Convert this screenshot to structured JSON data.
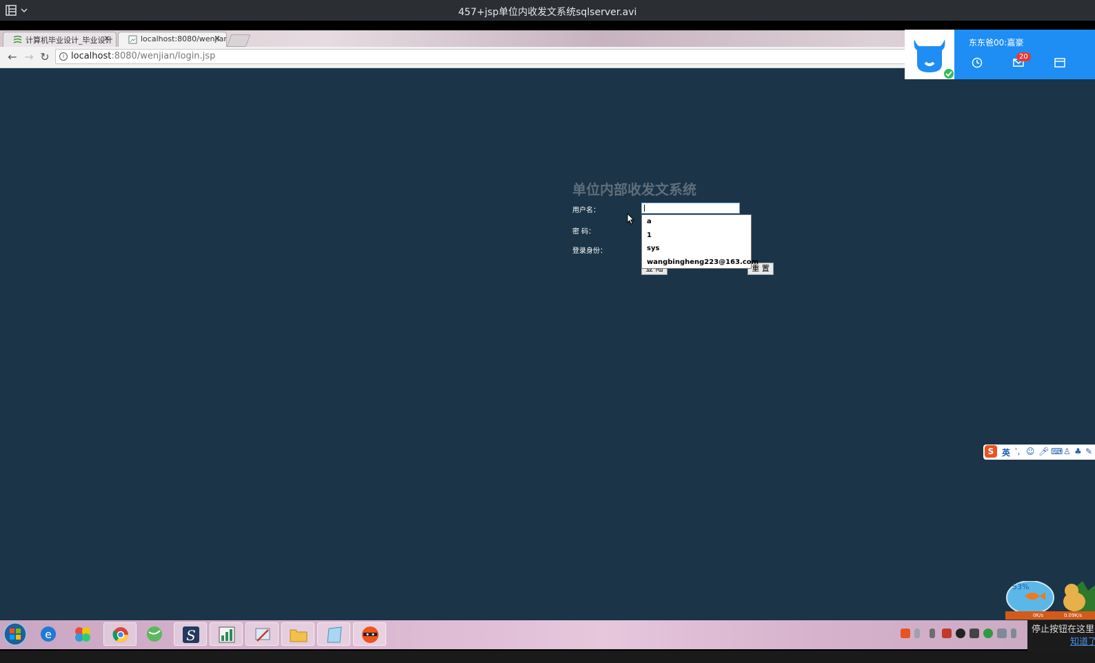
{
  "player": {
    "title": "457+jsp单位内收发文系统sqlserver.avi"
  },
  "browser": {
    "tabs": [
      {
        "label": "计算机毕业设计_毕业设计"
      },
      {
        "label": "localhost:8080/wenjian/"
      }
    ],
    "url": {
      "host": "localhost",
      "path": ":8080/wenjian/login.jsp"
    }
  },
  "login": {
    "title": "单位内部收发文系统",
    "username_label": "用户名：",
    "password_label": "密 码：",
    "role_label": "登录身份：",
    "login_button": "登 陆",
    "reset_button": "重 置",
    "autocomplete": [
      "a",
      "1",
      "sys",
      "wangbingheng223@163.com"
    ]
  },
  "notification": {
    "name": "东东爸00:嘉豪",
    "badge": "20"
  },
  "ime": {
    "mode": "英"
  },
  "widget": {
    "percent": "53%",
    "up": "0K/s",
    "down": "0.09K/s"
  },
  "stop_note": {
    "line1": "停止按钮在这里",
    "line2": "知道了"
  },
  "colors": {
    "page_bg": "#1b3447",
    "notif_bg": "#1e8ef5"
  }
}
